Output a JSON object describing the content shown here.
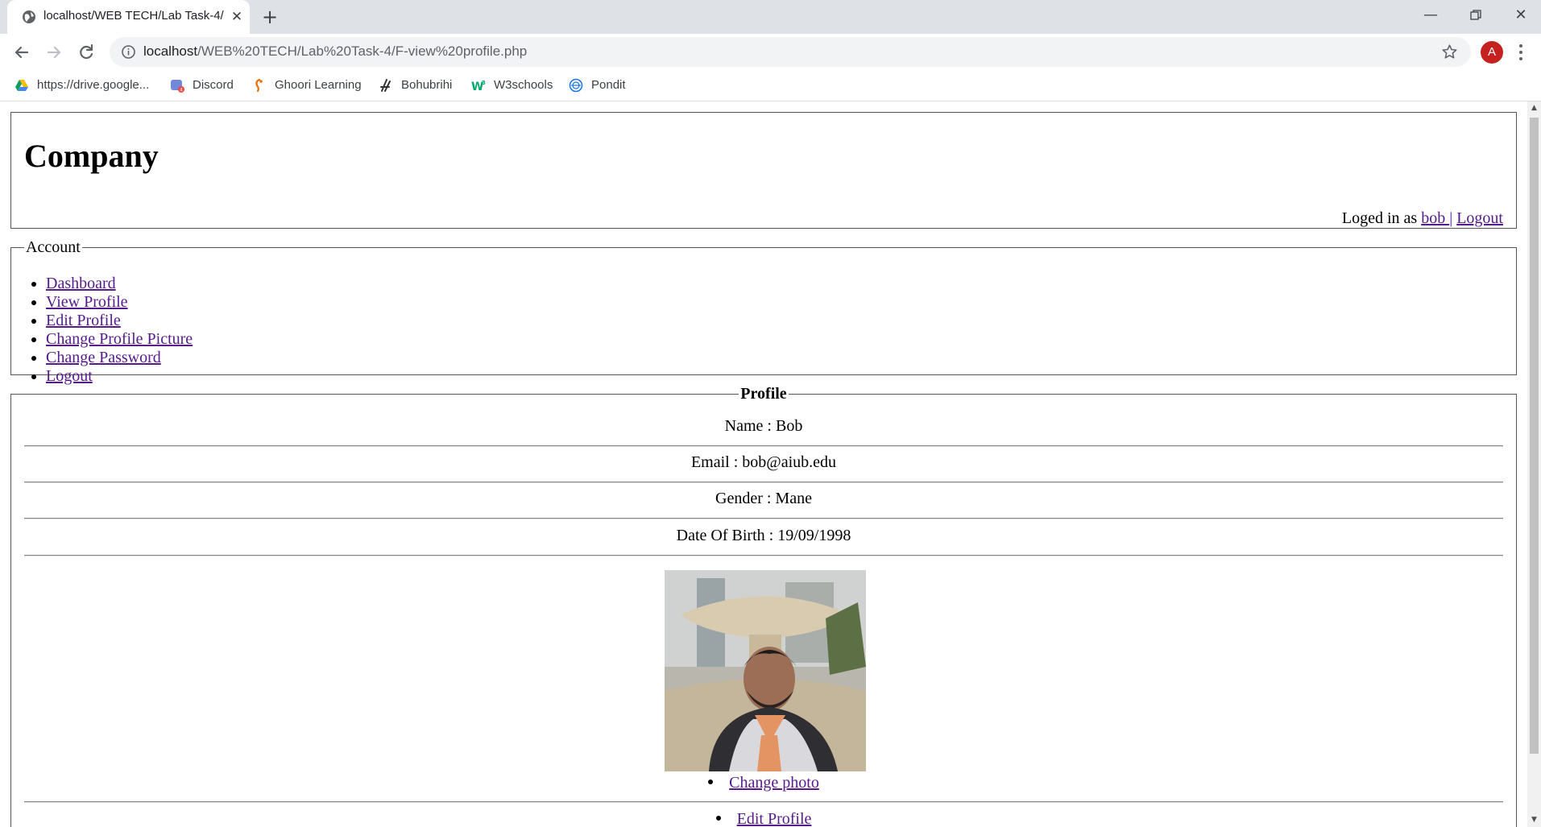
{
  "browser": {
    "tab_title": "localhost/WEB TECH/Lab Task-4/",
    "url_host": "localhost",
    "url_path": "/WEB%20TECH/Lab%20Task-4/F-view%20profile.php",
    "profile_initial": "A",
    "bookmarks": [
      {
        "label": "https://drive.google...",
        "icon": "google-drive-icon"
      },
      {
        "label": "Discord",
        "icon": "discord-icon"
      },
      {
        "label": "Ghoori Learning",
        "icon": "ghoori-icon"
      },
      {
        "label": "Bohubrihi",
        "icon": "bohubrihi-icon"
      },
      {
        "label": "W3schools",
        "icon": "w3schools-icon"
      },
      {
        "label": "Pondit",
        "icon": "pondit-icon"
      }
    ]
  },
  "page": {
    "header": {
      "title": "Company",
      "logged_in_prefix": "Loged in as ",
      "username_link": "bob ",
      "separator": "|",
      "logout_link": "Logout"
    },
    "account": {
      "legend": "Account",
      "items": [
        "Dashboard",
        "View Profile",
        "Edit Profile",
        "Change Profile Picture",
        "Change Password",
        "Logout"
      ]
    },
    "profile": {
      "legend": "Profile",
      "name_line": "Name : Bob",
      "email_line": "Email : bob@aiub.edu",
      "gender_line": "Gender : Mane",
      "dob_line": "Date Of Birth : 19/09/1998",
      "change_photo_link": "Change photo",
      "edit_profile_link": "Edit Profile"
    }
  },
  "colors": {
    "link": "#551a8b",
    "chrome_bg": "#dee1e6",
    "avatar_bg": "#c5221f"
  }
}
